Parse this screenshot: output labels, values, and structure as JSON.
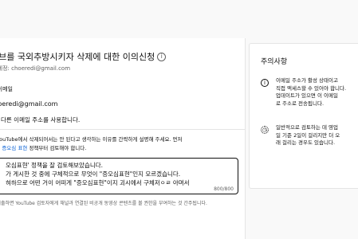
{
  "form": {
    "title": "튜브를 국외추방시키자 삭제에 대한 이의신청",
    "info_icon": "info-icon",
    "account_line": "인 계정: choeredi@gmail.com",
    "email_section_label": "저 이메일",
    "email_value": "choeredi@gmail.com",
    "other_email_checkbox_label": "다른 이메일 주소를 사용합니다.",
    "instruction_line1": "이 YouTube에서 삭제되어서는 안 된다고 생각하는 이유를 간략하게 설명해 주세요. 먼저",
    "instruction_line2_prefix": "ube ",
    "instruction_link": "증오심 표현",
    "instruction_line2_suffix": " 정책부터 검토해야 합니다.",
    "appeal_text_lines": [
      "오심표현' 정책을 잘 검토해보았습니다.",
      "가 게시한 것 중에 구체적으로 무엇이 \"증오심표현\"인지 모르겠습니다.",
      "혀하으로 어떤 거이 어떠게 \"증오심표현\"이지 괴시에서 구체저ㅇㄹ 아며서"
    ],
    "char_counter": "800/800",
    "disclaimer": "을 제출하면 YouTube 검토자에게 채널과 연결된 비공개 동영상 콘텐츠를 볼 권한을 부여하는 것 간주됩니다."
  },
  "notice": {
    "title": "주의사항",
    "items": [
      {
        "icon": "info-icon",
        "lines": [
          "이메일 주소가 활성 상태이고",
          "직접 액세스할 수 있어야 합니다.",
          "업데이트가 있으면 이 이메일",
          "로 주소로 전송됩니다."
        ]
      },
      {
        "icon": "clock-icon",
        "lines": [
          "일반적으로 검토하는 데 영업",
          "일 기준 2일이 걸리지만 더 오",
          "래 걸리는 경우도 있습니다."
        ]
      }
    ]
  }
}
